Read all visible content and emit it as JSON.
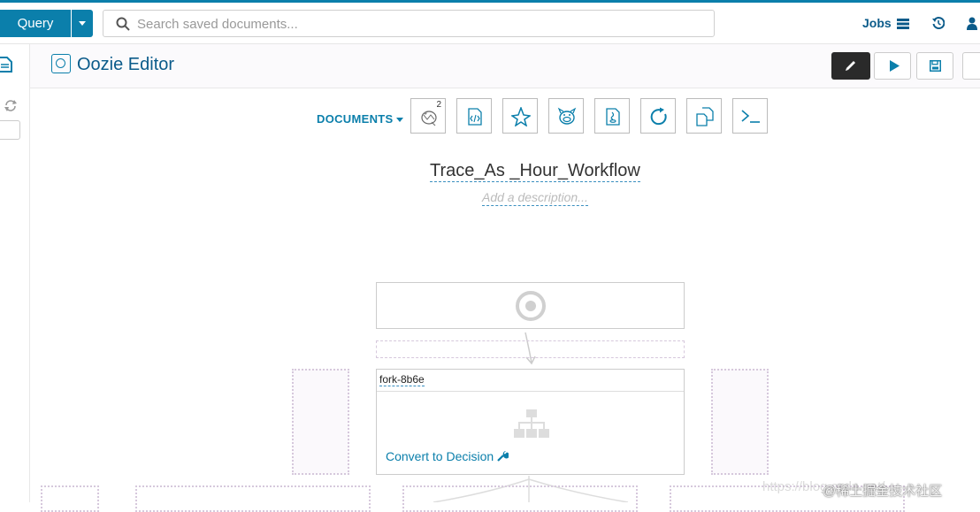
{
  "topbar": {
    "query_label": "Query",
    "search_placeholder": "Search saved documents...",
    "jobs_label": "Jobs"
  },
  "subbar": {
    "title": "Oozie Editor"
  },
  "toolbar": {
    "documents_label": "DOCUMENTS",
    "hive_badge": "2",
    "icons": [
      "hive-icon",
      "script-icon",
      "spark-icon",
      "pig-icon",
      "java-icon",
      "sub-workflow-icon",
      "distcp-icon",
      "shell-icon"
    ]
  },
  "workflow": {
    "name": "Trace_As _Hour_Workflow",
    "description_placeholder": "Add a description..."
  },
  "fork": {
    "name": "fork-8b6e",
    "convert_label": "Convert to Decision"
  },
  "watermark": {
    "text": "@稀土掘金技术社区",
    "url": "https://blog.csdn.net/..."
  },
  "colors": {
    "accent": "#0b7fab",
    "title": "#0b5b8a",
    "dark_button": "#2a2a2a",
    "drop_border": "#d6c8dc"
  }
}
